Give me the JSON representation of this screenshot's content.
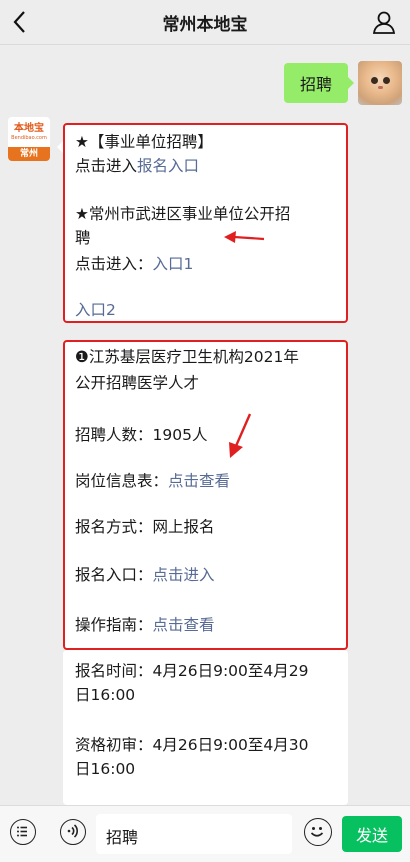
{
  "header": {
    "title": "常州本地宝"
  },
  "user_message": {
    "text": "招聘"
  },
  "account": {
    "logo_name": "本地宝",
    "logo_sub": "Bendibao.com",
    "logo_city": "常州"
  },
  "card1": {
    "l1": "★【事业单位招聘】",
    "l2_prefix": "点击进入",
    "l2_link": "报名入口",
    "l3": "★常州市武进区事业单位公开招",
    "l4": "聘",
    "l5_prefix": "点击进入：",
    "l5_link": "入口1",
    "l6_link": "入口2"
  },
  "card2": {
    "l1": "❶江苏基层医疗卫生机构2021年",
    "l2": "公开招聘医学人才",
    "l3": "招聘人数：1905人",
    "l4_prefix": "岗位信息表：",
    "l4_link": "点击查看",
    "l5": "报名方式：网上报名",
    "l6_prefix": "报名入口：",
    "l6_link": "点击进入",
    "l7_prefix": "操作指南：",
    "l7_link": "点击查看"
  },
  "card3": {
    "l1": "报名时间：4月26日9:00至4月29",
    "l2": "日16:00",
    "l3": "资格初审：4月26日9:00至4月30",
    "l4": "日16:00"
  },
  "bottom": {
    "input_value": "招聘",
    "send_label": "发送"
  },
  "colors": {
    "bubble": "#95ec69",
    "link": "#576b95",
    "highlight": "#e02020",
    "send": "#07c160"
  }
}
